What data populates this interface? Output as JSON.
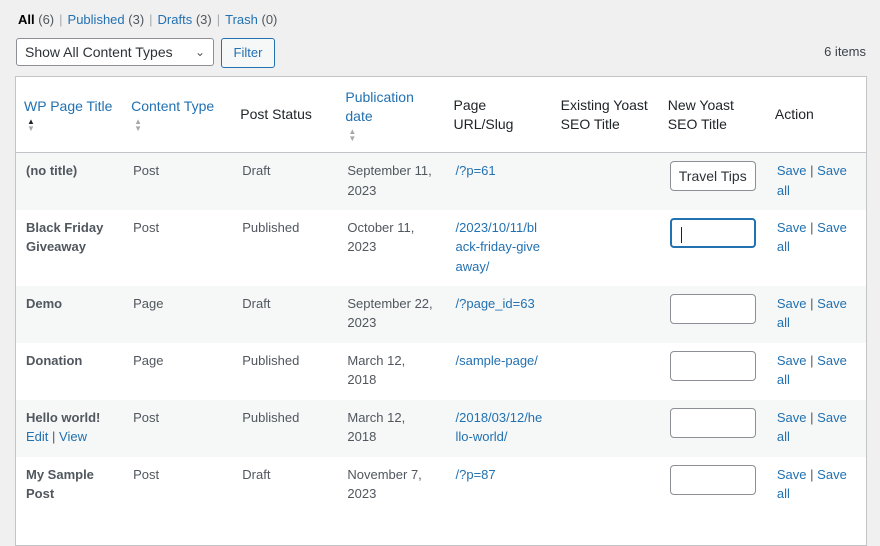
{
  "views": [
    {
      "label": "All",
      "count": "(6)",
      "current": true
    },
    {
      "label": "Published",
      "count": "(3)",
      "current": false
    },
    {
      "label": "Drafts",
      "count": "(3)",
      "current": false
    },
    {
      "label": "Trash",
      "count": "(0)",
      "current": false
    }
  ],
  "filter": {
    "content_type_selected": "Show All Content Types",
    "filter_button": "Filter",
    "items_count": "6 items"
  },
  "colors": {
    "link": "#2271b1",
    "row_alt": "#f6f7f7",
    "border": "#c3c4c7"
  },
  "table": {
    "headers": {
      "title": "WP Page Title",
      "content_type": "Content Type",
      "status": "Post Status",
      "date": "Publication date",
      "url": "Page URL/Slug",
      "existing_seo": "Existing Yoast SEO Title",
      "new_seo": "New Yoast SEO Title",
      "action": "Action"
    },
    "sort": {
      "column": "title",
      "direction": "asc"
    },
    "action_labels": {
      "save": "Save",
      "save_all": "Save all",
      "edit": "Edit",
      "view": "View"
    },
    "rows": [
      {
        "title": "(no title)",
        "type": "Post",
        "status": "Draft",
        "date": "September 11, 2023",
        "url": "/?p=61",
        "existing_seo": "",
        "new_seo": "Travel Tips"
      },
      {
        "title": "Black Friday Giveaway",
        "type": "Post",
        "status": "Published",
        "date": "October 11, 2023",
        "url": "/2023/10/11/black-friday-giveaway/",
        "existing_seo": "",
        "new_seo": ""
      },
      {
        "title": "Demo",
        "type": "Page",
        "status": "Draft",
        "date": "September 22, 2023",
        "url": "/?page_id=63",
        "existing_seo": "",
        "new_seo": ""
      },
      {
        "title": "Donation",
        "type": "Page",
        "status": "Published",
        "date": "March 12, 2018",
        "url": "/sample-page/",
        "existing_seo": "",
        "new_seo": ""
      },
      {
        "title": "Hello world!",
        "type": "Post",
        "status": "Published",
        "date": "March 12, 2018",
        "url": "/2018/03/12/hello-world/",
        "existing_seo": "",
        "new_seo": ""
      },
      {
        "title": "My Sample Post",
        "type": "Post",
        "status": "Draft",
        "date": "November 7, 2023",
        "url": "/?p=87",
        "existing_seo": "",
        "new_seo": ""
      }
    ]
  }
}
